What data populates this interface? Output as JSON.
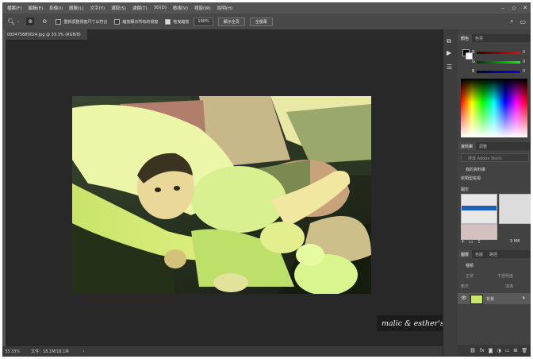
{
  "menu": [
    "檔案(F)",
    "編輯(E)",
    "影像(I)",
    "圖層(L)",
    "文字(Y)",
    "選取(S)",
    "濾鏡(T)",
    "3D(D)",
    "檢視(V)",
    "視窗(W)",
    "說明(H)"
  ],
  "options": {
    "resize_windows_label": "重新調整視窗尺寸以符合",
    "zoom_all_windows_label": "縮放顯示所有的視窗",
    "scrubby_zoom_label": "拖曳縮放",
    "zoom_value": "100%",
    "fit_screen_label": "顯示全頁",
    "fill_screen_label": "全螢幕"
  },
  "document": {
    "tab_title": "000475680024.jpg @ 33.3% (RGB/8)"
  },
  "status": {
    "zoom": "33.33%",
    "doc_size": "文件：18.1M/18.1M"
  },
  "watermark": "malic & esther's underdog",
  "color_panel": {
    "tabs": [
      "顏色",
      "色票"
    ],
    "r_label": "R",
    "g_label": "G",
    "b_label": "B",
    "r_value": "0",
    "g_value": "0",
    "b_value": "0"
  },
  "library_panel": {
    "tabs": [
      "資料庫",
      "調整"
    ],
    "search_placeholder": "搜尋 Adobe Stock",
    "my_library": "我的資料庫",
    "view_by": "依類型檢視",
    "group_label": "圖形",
    "size_label": "9 MB"
  },
  "layers_panel": {
    "tabs": [
      "圖層",
      "色版",
      "路徑"
    ],
    "kind_label": "種類",
    "blend_mode": "正常",
    "opacity_label": "不透明度",
    "lock_label": "鎖定",
    "fill_label": "填滿",
    "layer_name": "背景"
  },
  "colors": {
    "ui_dark": "#323232",
    "canvas_bg": "#282828",
    "photo_tint": "#c8f070"
  }
}
